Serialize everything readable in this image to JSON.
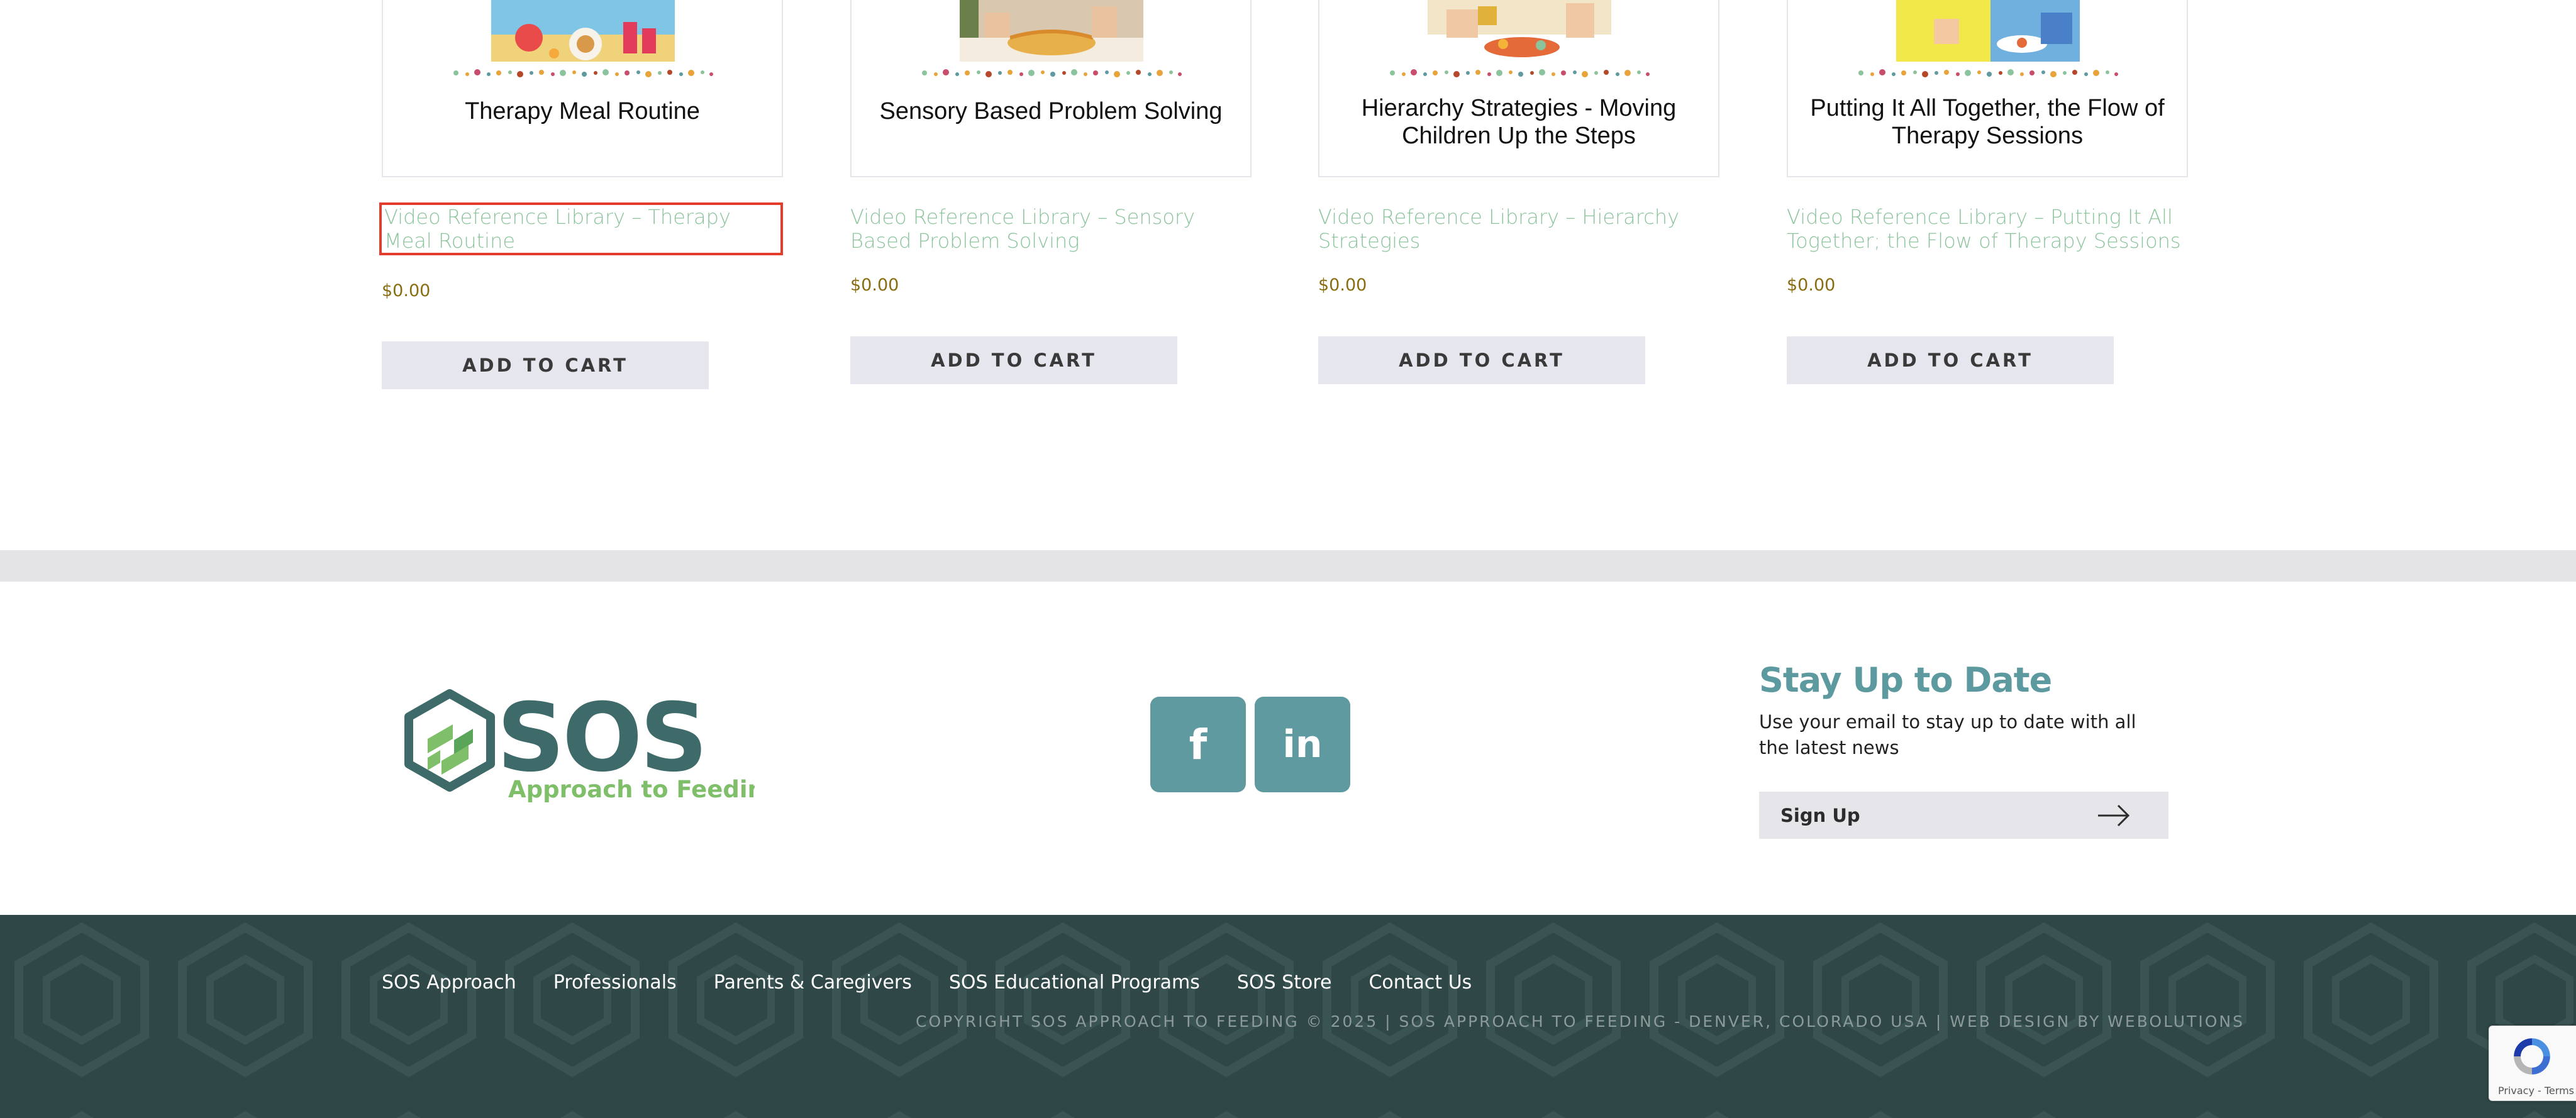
{
  "products": [
    {
      "card_title": "Therapy Meal Routine",
      "link": "Video Reference Library – Therapy Meal Routine",
      "price": "$0.00",
      "button": "ADD TO CART"
    },
    {
      "card_title": "Sensory Based Problem Solving",
      "link": "Video Reference Library – Sensory Based Problem Solving",
      "price": "$0.00",
      "button": "ADD TO CART"
    },
    {
      "card_title": "Hierarchy Strategies - Moving Children Up the Steps",
      "link": "Video Reference Library – Hierarchy Strategies",
      "price": "$0.00",
      "button": "ADD TO CART"
    },
    {
      "card_title": "Putting It All Together, the Flow of Therapy Sessions",
      "link": "Video Reference Library – Putting It All Together; the Flow of Therapy Sessions",
      "price": "$0.00",
      "button": "ADD TO CART"
    }
  ],
  "footer": {
    "logo_main": "SOS",
    "logo_sub": "Approach to Feeding",
    "logo_reg": "®",
    "social": {
      "facebook": "f",
      "linkedin": "in"
    },
    "newsletter": {
      "title": "Stay Up to Date",
      "text": "Use your email to stay up to date with all the latest news",
      "button": "Sign Up"
    },
    "nav": [
      "SOS Approach",
      "Professionals",
      "Parents & Caregivers",
      "SOS Educational Programs",
      "SOS Store",
      "Contact Us"
    ],
    "copyright": "COPYRIGHT SOS APPROACH TO FEEDING © 2025 | SOS APPROACH TO FEEDING - DENVER, COLORADO USA | WEB DESIGN BY WEBOLUTIONS"
  },
  "recaptcha": {
    "text": "Privacy - Terms"
  },
  "colors": {
    "link_green": "#8bc49c",
    "price_gold": "#8a6d12",
    "teal": "#5e9aa0",
    "footer_dark": "#2f4747",
    "selection_red": "#e53b2c"
  },
  "icons": [
    "facebook-icon",
    "linkedin-icon",
    "arrow-right-icon",
    "recaptcha-icon",
    "sos-logo"
  ]
}
